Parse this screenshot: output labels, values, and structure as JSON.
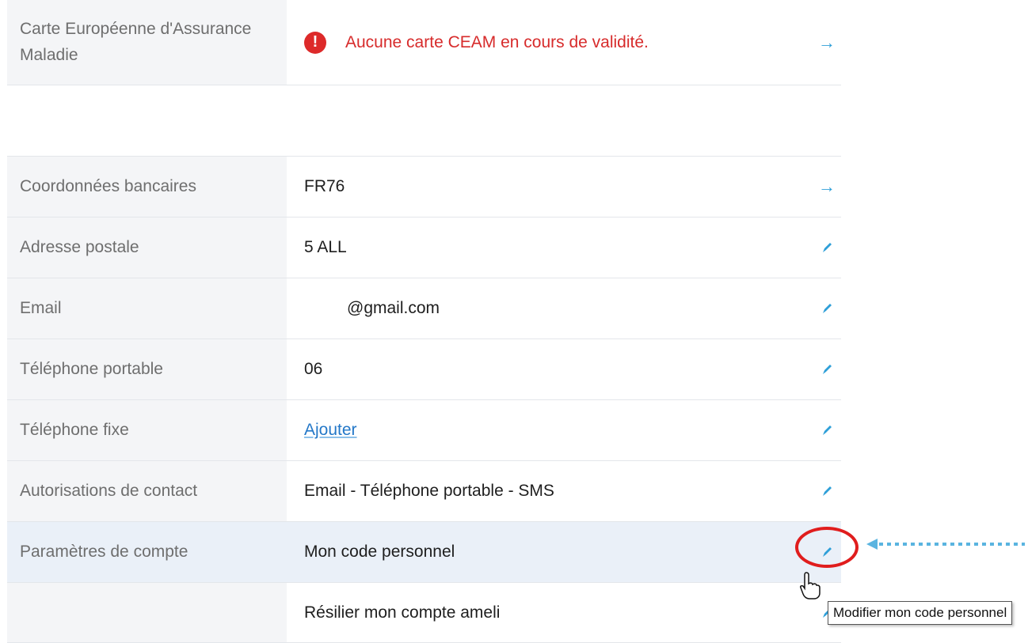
{
  "ceam": {
    "label": "Carte Européenne d'Assurance Maladie",
    "alert_text": "Aucune carte CEAM en cours de validité.",
    "alert_icon": "alert-icon",
    "action_icon": "arrow-right-icon"
  },
  "rows": [
    {
      "label": "Coordonnées bancaires",
      "value": "FR76",
      "action": "arrow-right-icon"
    },
    {
      "label": "Adresse postale",
      "value": "5 ALL",
      "action": "pencil-icon"
    },
    {
      "label": "Email",
      "value": "@gmail.com",
      "action": "pencil-icon"
    },
    {
      "label": "Téléphone portable",
      "value": "06",
      "action": "pencil-icon"
    },
    {
      "label": "Téléphone fixe",
      "value": "Ajouter",
      "action": "pencil-icon"
    },
    {
      "label": "Autorisations de contact",
      "value": "Email - Téléphone portable - SMS",
      "action": "pencil-icon"
    },
    {
      "label": "Paramètres de compte",
      "value": "Mon code personnel",
      "action": "pencil-icon"
    },
    {
      "label": "",
      "value": "Résilier mon compte ameli",
      "action": "pencil-icon"
    }
  ],
  "tooltip": "Modifier mon code personnel",
  "colors": {
    "accent": "#2e9fd8",
    "alert": "#d72b2b",
    "link": "#2478c8",
    "highlight": "#eaf0f8",
    "annotation": "#e01d1d",
    "pointer": "#5ab4e0"
  }
}
